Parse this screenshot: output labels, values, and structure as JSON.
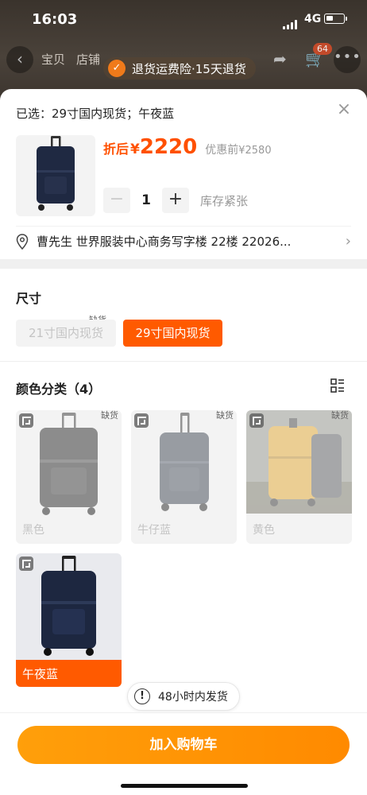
{
  "status_bar": {
    "time": "16:03",
    "network": "4G"
  },
  "nav": {
    "tab1": "宝贝",
    "tab2": "店铺",
    "cart_badge": "64"
  },
  "return_banner": {
    "text": "退货运费险·15天退货"
  },
  "sheet": {
    "selected_text": "已选：29寸国内现货；午夜蓝",
    "price_label": "折后",
    "price_symbol": "¥",
    "price_value": "2220",
    "pre_label": "优惠前",
    "pre_value": "¥2580",
    "quantity": "1",
    "stock_text": "库存紧张",
    "address": "曹先生 世界服装中心商务写字楼 22楼 22026..."
  },
  "size_section": {
    "title": "尺寸",
    "options": [
      {
        "label": "21寸国内现货",
        "tag": "缺货"
      },
      {
        "label": "29寸国内现货"
      }
    ]
  },
  "color_section": {
    "title": "颜色分类（4）",
    "items": [
      {
        "name": "黑色",
        "tag": "缺货"
      },
      {
        "name": "牛仔蓝",
        "tag": "缺货"
      },
      {
        "name": "黄色",
        "tag": "缺货"
      },
      {
        "name": "午夜蓝"
      }
    ]
  },
  "shipping_note": "48小时内发货",
  "cart_button": "加入购物车",
  "colors": {
    "accent": "#ff5a00",
    "button_start": "#ff9f0a",
    "button_end": "#ff8a00"
  }
}
